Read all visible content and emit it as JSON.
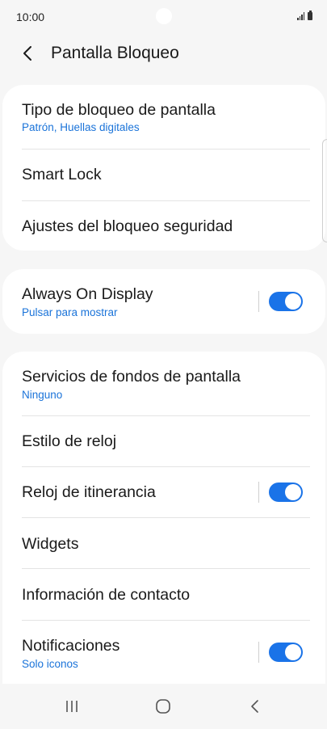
{
  "status_bar": {
    "time": "10:00"
  },
  "header": {
    "title": "Pantalla Bloqueo"
  },
  "sections": [
    {
      "items": [
        {
          "title": "Tipo de bloqueo de pantalla",
          "subtitle": "Patrón, Huellas digitales"
        },
        {
          "title": "Smart Lock"
        },
        {
          "title": "Ajustes del bloqueo seguridad"
        }
      ]
    },
    {
      "items": [
        {
          "title": "Always On Display",
          "subtitle": "Pulsar para mostrar",
          "toggle": true
        }
      ]
    },
    {
      "items": [
        {
          "title": "Servicios de fondos de pantalla",
          "subtitle": "Ninguno"
        },
        {
          "title": "Estilo de reloj"
        },
        {
          "title": "Reloj de itinerancia",
          "toggle": true
        },
        {
          "title": "Widgets"
        },
        {
          "title": "Información de contacto"
        },
        {
          "title": "Notificaciones",
          "subtitle": "Solo iconos",
          "toggle": true
        }
      ]
    }
  ],
  "colors": {
    "accent": "#1a73e8",
    "subtitle": "#1a73d9",
    "background": "#f6f6f6",
    "card": "#ffffff"
  },
  "icons": {
    "back": "chevron-left-icon",
    "nav_recents": "recents-icon",
    "nav_home": "home-icon",
    "nav_back": "back-icon"
  }
}
